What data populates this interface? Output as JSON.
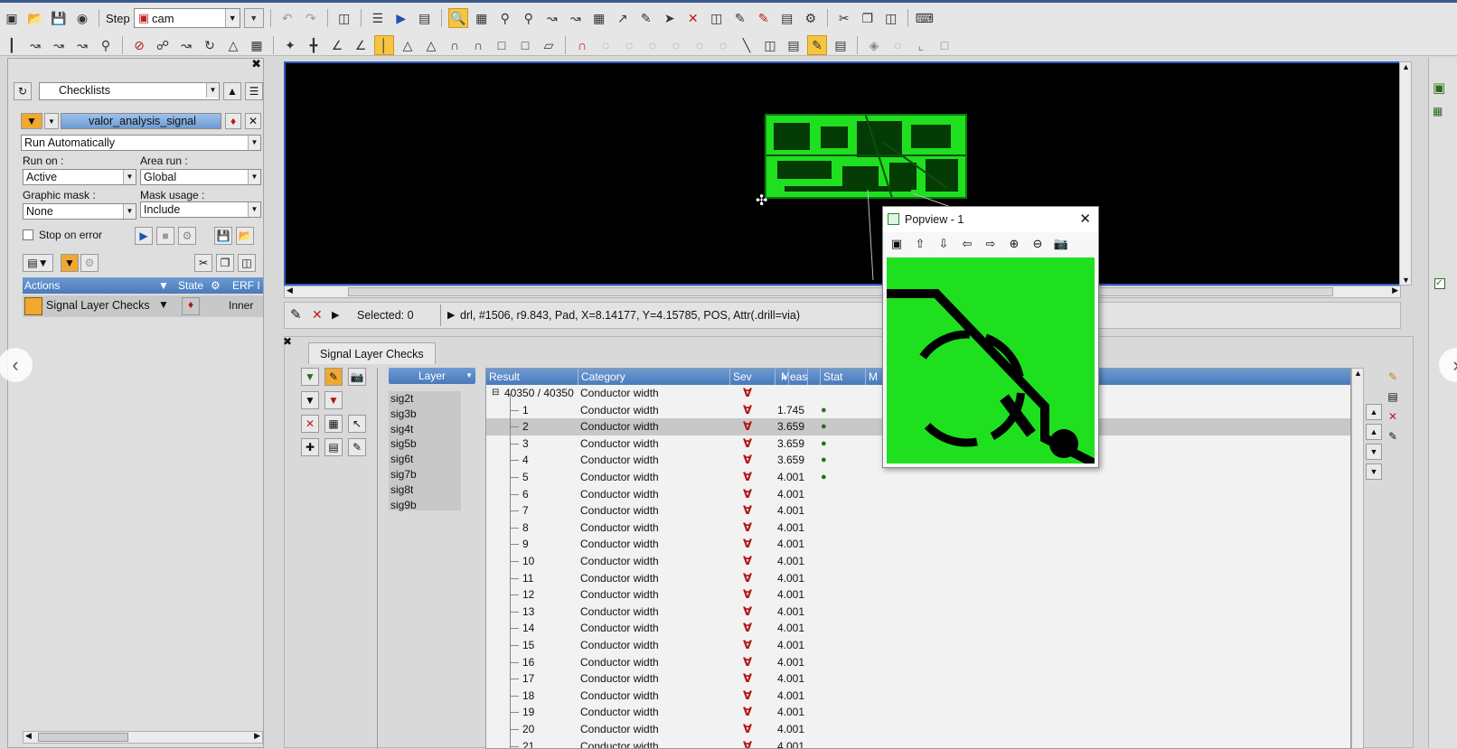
{
  "toolbar": {
    "step_label": "Step",
    "step_value": "cam"
  },
  "checklists": {
    "combo": "Checklists",
    "checklist_name": "valor_analysis_signal",
    "run_mode": "Run Automatically",
    "run_on_label": "Run on :",
    "run_on_value": "Active",
    "area_run_label": "Area run :",
    "area_run_value": "Global",
    "graphic_mask_label": "Graphic mask :",
    "graphic_mask_value": "None",
    "mask_usage_label": "Mask usage :",
    "mask_usage_value": "Include",
    "stop_on_error": "Stop on error",
    "headers": {
      "actions": "Actions",
      "state": "State",
      "erf": "ERF I"
    },
    "action_row": {
      "name": "Signal Layer Checks",
      "erf": "Inner"
    }
  },
  "status": {
    "selected": "Selected: 0",
    "info": "drl, #1506, r9.843, Pad, X=8.14177, Y=4.15785, POS, Attr(.drill=via)"
  },
  "results_panel": {
    "tab": "Signal Layer Checks",
    "layer_header": "Layer",
    "layers": [
      "sig2t",
      "sig3b",
      "sig4t",
      "sig5b",
      "sig6t",
      "sig7b",
      "sig8t",
      "sig9b"
    ],
    "headers": {
      "result": "Result",
      "category": "Category",
      "sev": "Sev",
      "meas": "Meas",
      "stat": "Stat",
      "more": "M"
    },
    "group": {
      "result": "40350 / 40350",
      "category": "Conductor width"
    },
    "rows": [
      {
        "result": "1",
        "category": "Conductor width",
        "meas": "1.745"
      },
      {
        "result": "2",
        "category": "Conductor width",
        "meas": "3.659"
      },
      {
        "result": "3",
        "category": "Conductor width",
        "meas": "3.659"
      },
      {
        "result": "4",
        "category": "Conductor width",
        "meas": "3.659"
      },
      {
        "result": "5",
        "category": "Conductor width",
        "meas": "4.001"
      },
      {
        "result": "6",
        "category": "Conductor width",
        "meas": "4.001"
      },
      {
        "result": "7",
        "category": "Conductor width",
        "meas": "4.001"
      },
      {
        "result": "8",
        "category": "Conductor width",
        "meas": "4.001"
      },
      {
        "result": "9",
        "category": "Conductor width",
        "meas": "4.001"
      },
      {
        "result": "10",
        "category": "Conductor width",
        "meas": "4.001"
      },
      {
        "result": "11",
        "category": "Conductor width",
        "meas": "4.001"
      },
      {
        "result": "12",
        "category": "Conductor width",
        "meas": "4.001"
      },
      {
        "result": "13",
        "category": "Conductor width",
        "meas": "4.001"
      },
      {
        "result": "14",
        "category": "Conductor width",
        "meas": "4.001"
      },
      {
        "result": "15",
        "category": "Conductor width",
        "meas": "4.001"
      },
      {
        "result": "16",
        "category": "Conductor width",
        "meas": "4.001"
      },
      {
        "result": "17",
        "category": "Conductor width",
        "meas": "4.001"
      },
      {
        "result": "18",
        "category": "Conductor width",
        "meas": "4.001"
      },
      {
        "result": "19",
        "category": "Conductor width",
        "meas": "4.001"
      },
      {
        "result": "20",
        "category": "Conductor width",
        "meas": "4.001"
      },
      {
        "result": "21",
        "category": "Conductor width",
        "meas": "4.001"
      }
    ],
    "selected_row": "2"
  },
  "popview": {
    "title": "Popview - 1"
  },
  "colors": {
    "pcb_green": "#1fe01f",
    "canvas_black": "#000000",
    "header_blue": "#4a7abb",
    "severity_red": "#b01818"
  }
}
